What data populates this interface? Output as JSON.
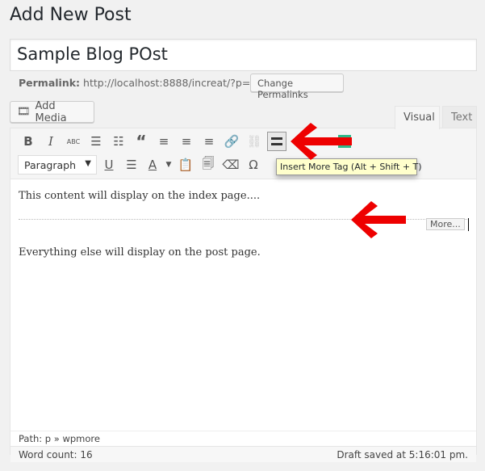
{
  "page": {
    "title": "Add New Post"
  },
  "post": {
    "title": "Sample Blog POst",
    "permalink_label": "Permalink:",
    "permalink_url": "http://localhost:8888/increat/?p=29",
    "change_permalinks": "Change Permalinks"
  },
  "media": {
    "add_media": "Add Media"
  },
  "tabs": {
    "visual": "Visual",
    "text": "Text"
  },
  "toolbar": {
    "format_select": "Paragraph",
    "tooltip": "Insert More Tag (Alt + Shift + T)",
    "abc": "ABC"
  },
  "content": {
    "line1": "This content will display on the index page....",
    "more_label": "More...",
    "line2": "Everything else will display on the post page."
  },
  "status": {
    "path": "Path: p » wpmore",
    "word_count": "Word count: 16",
    "draft_saved": "Draft saved at 5:16:01 pm."
  },
  "colors": {
    "arrow": "#ee0000",
    "accent_green": "#2fb98a"
  }
}
